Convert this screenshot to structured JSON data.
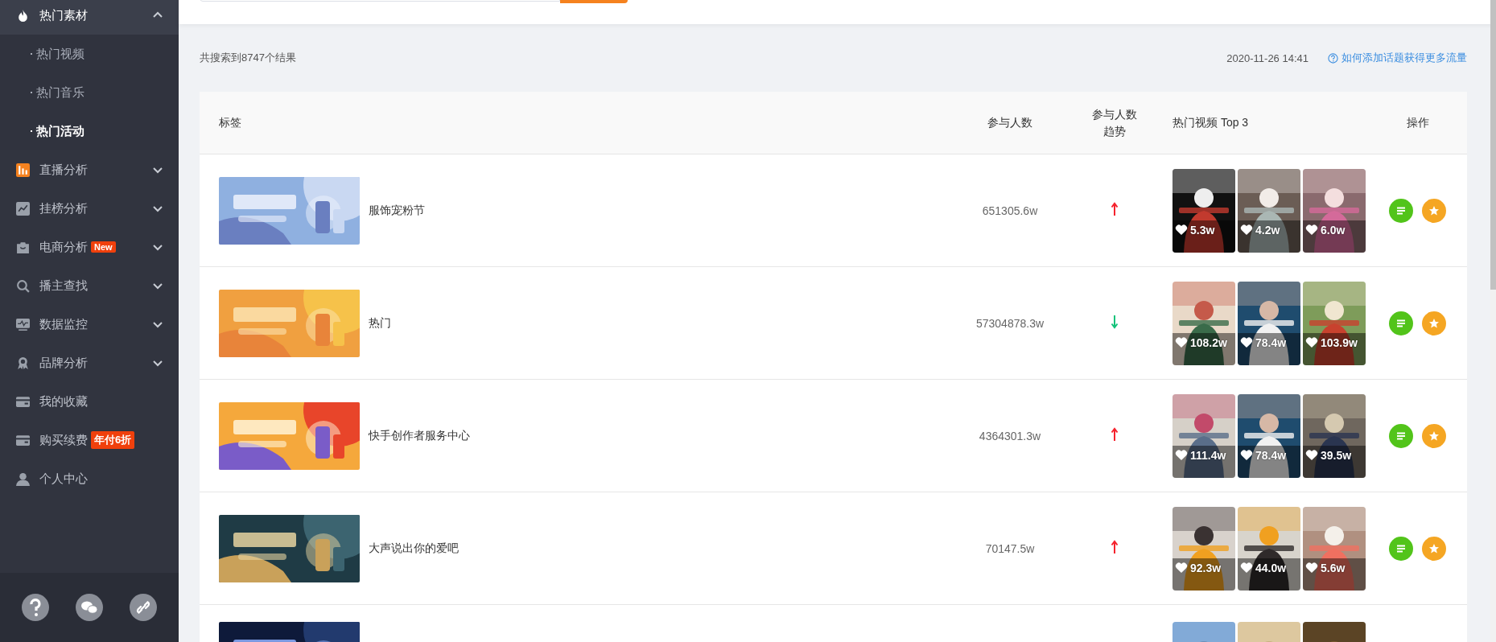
{
  "sidebar": {
    "items": [
      {
        "kind": "group",
        "label": "热门素材",
        "expanded": true,
        "children": [
          {
            "label": "热门视频",
            "selected": false
          },
          {
            "label": "热门音乐",
            "selected": false
          },
          {
            "label": "热门活动",
            "selected": true
          }
        ]
      },
      {
        "kind": "group",
        "label": "直播分析",
        "expanded": false
      },
      {
        "kind": "group",
        "label": "挂榜分析",
        "expanded": false
      },
      {
        "kind": "group",
        "label": "电商分析",
        "badge": "New",
        "expanded": false
      },
      {
        "kind": "group",
        "label": "播主查找",
        "expanded": false
      },
      {
        "kind": "group",
        "label": "数据监控",
        "expanded": false
      },
      {
        "kind": "group",
        "label": "品牌分析",
        "expanded": false
      },
      {
        "kind": "link",
        "label": "我的收藏"
      },
      {
        "kind": "link",
        "label": "购买续费",
        "badge": "年付6折"
      },
      {
        "kind": "link",
        "label": "个人中心"
      }
    ]
  },
  "results": {
    "summary": "共搜索到8747个结果",
    "updated": "2020-11-26 14:41",
    "help_link": "如何添加话题获得更多流量"
  },
  "table": {
    "columns": [
      "标签",
      "参与人数",
      "参与人数趋势",
      "热门视频 Top 3",
      "操作"
    ],
    "rows": [
      {
        "kind": "full",
        "name": "服饰宠粉节",
        "participants": "651305.6w",
        "rising": true,
        "videos": [
          "5.3w",
          "4.2w",
          "6.0w"
        ]
      },
      {
        "kind": "full",
        "name": "热门",
        "participants": "57304878.3w",
        "rising": false,
        "videos": [
          "108.2w",
          "78.4w",
          "103.9w"
        ]
      },
      {
        "kind": "full",
        "name": "快手创作者服务中心",
        "participants": "4364301.3w",
        "rising": true,
        "videos": [
          "111.4w",
          "78.4w",
          "39.5w"
        ]
      },
      {
        "kind": "full",
        "name": "大声说出你的爱吧",
        "participants": "70147.5w",
        "rising": true,
        "videos": [
          "92.3w",
          "44.0w",
          "5.6w"
        ]
      },
      {
        "kind": "partial"
      }
    ]
  }
}
